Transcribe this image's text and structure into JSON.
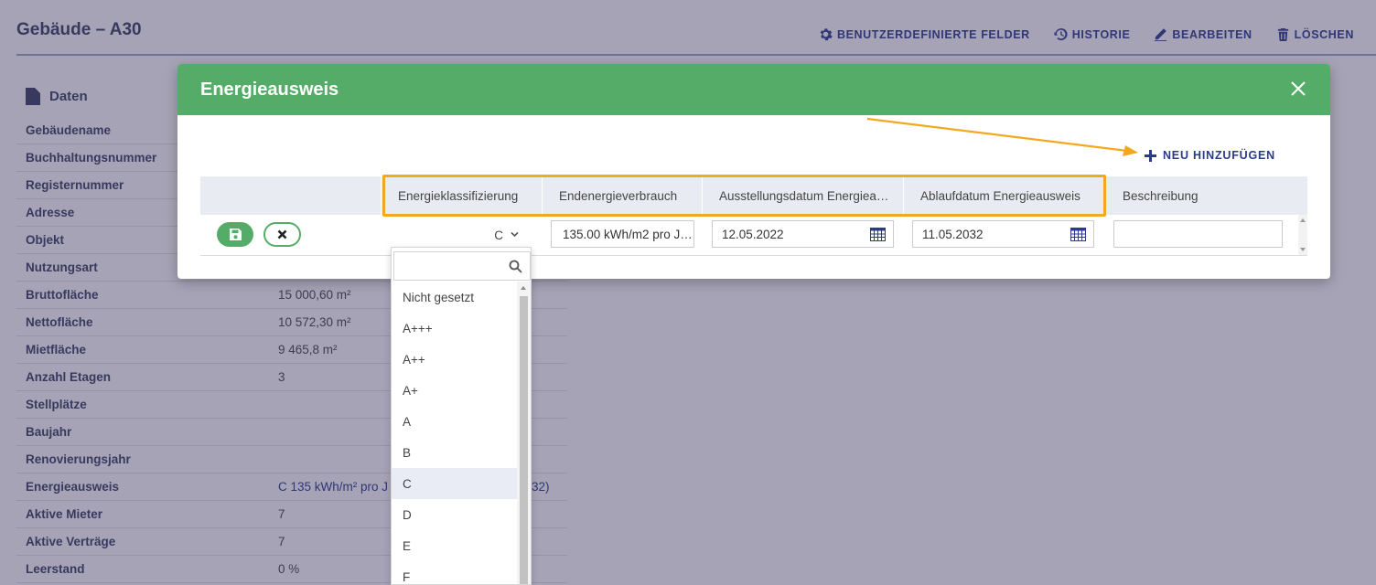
{
  "page": {
    "title": "Gebäude – A30"
  },
  "toolbar": {
    "custom_fields": "BENUTZERDEFINIERTE FELDER",
    "history": "HISTORIE",
    "edit": "BEARBEITEN",
    "delete": "LÖSCHEN"
  },
  "section": {
    "title": "Daten"
  },
  "data_rows": [
    {
      "label": "Gebäudename",
      "value": ""
    },
    {
      "label": "Buchhaltungsnummer",
      "value": ""
    },
    {
      "label": "Registernummer",
      "value": ""
    },
    {
      "label": "Adresse",
      "value": ""
    },
    {
      "label": "Objekt",
      "value": ""
    },
    {
      "label": "Nutzungsart",
      "value": ""
    },
    {
      "label": "Bruttofläche",
      "value": "15 000,60 m²"
    },
    {
      "label": "Nettofläche",
      "value": "10 572,30 m²"
    },
    {
      "label": "Mietfläche",
      "value": "9 465,8 m²"
    },
    {
      "label": "Anzahl Etagen",
      "value": "3"
    },
    {
      "label": "Stellplätze",
      "value": ""
    },
    {
      "label": "Baujahr",
      "value": ""
    },
    {
      "label": "Renovierungsjahr",
      "value": ""
    },
    {
      "label": "Energieausweis",
      "value": "C 135 kWh/m² pro J",
      "value_tail": "32)"
    },
    {
      "label": "Aktive Mieter",
      "value": "7"
    },
    {
      "label": "Aktive Verträge",
      "value": "7"
    },
    {
      "label": "Leerstand",
      "value": "0 %"
    }
  ],
  "modal": {
    "title": "Energieausweis",
    "add_new": "NEU HINZUFÜGEN",
    "columns": [
      "",
      "Energieklassifizierung",
      "Endenergieverbrauch",
      "Ausstellungsdatum Energiea…",
      "Ablaufdatum Energieausweis",
      "Beschreibung"
    ],
    "row": {
      "classification": "C",
      "consumption": "135.00 kWh/m2 pro J…",
      "issue_date": "12.05.2022",
      "expiry_date": "11.05.2032",
      "description": ""
    }
  },
  "dropdown": {
    "search_value": "",
    "selected": "C",
    "options": [
      "Nicht gesetzt",
      "A+++",
      "A++",
      "A+",
      "A",
      "B",
      "C",
      "D",
      "E",
      "F"
    ]
  },
  "colors": {
    "accent_green": "#55ac68",
    "brand_blue": "#2b3a8c",
    "highlight_orange": "#f2a91f"
  }
}
